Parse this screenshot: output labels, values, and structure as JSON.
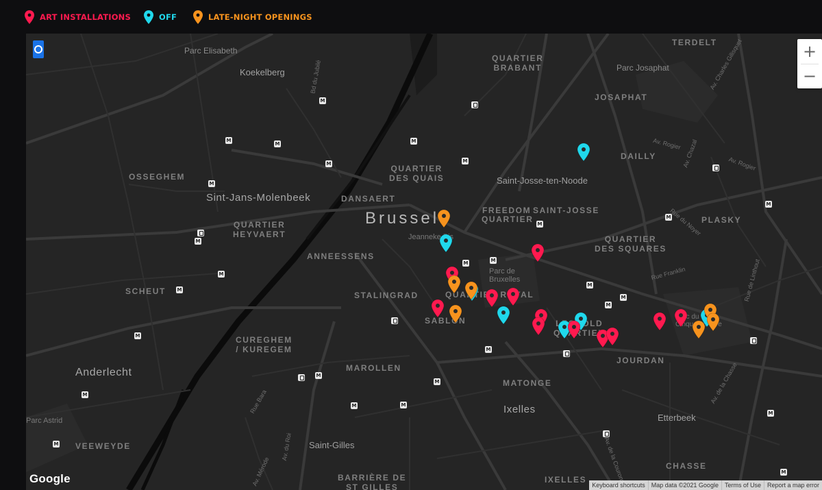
{
  "legend": {
    "items": [
      {
        "label": "ART INSTALLATIONS",
        "color": "#ff1a4f",
        "icon": "map-pin-icon"
      },
      {
        "label": "OFF",
        "color": "#20d8ec",
        "icon": "map-pin-icon"
      },
      {
        "label": "LATE-NIGHT OPENINGS",
        "color": "#f7931e",
        "icon": "map-pin-icon"
      }
    ]
  },
  "map": {
    "city": "Brussels",
    "towns": {
      "anderlecht": "Anderlecht",
      "ixelles": "Ixelles",
      "molenbeek": "Sint-Jans-Molenbeek",
      "saint_josse": "Saint-Josse-ten-Noode",
      "saint_gilles": "Saint-Gilles",
      "koekelberg": "Koekelberg",
      "etterbeek": "Etterbeek"
    },
    "districts": {
      "terdelt": "TERDELT",
      "quartier_brabant": "QUARTIER\nBRABANT",
      "josaphat": "JOSAPHAT",
      "dailly": "DAILLY",
      "osseghem": "OSSEGHEM",
      "quartier_quais": "QUARTIER\nDES QUAIS",
      "dansaert": "DANSAERT",
      "freedom": "FREEDOM",
      "saint_josse_q": "SAINT-JOSSE",
      "quartier": "QUARTIER",
      "plasky": "PLASKY",
      "heyvaert": "QUARTIER\nHEYVAERT",
      "squares": "QUARTIER\nDES SQUARES",
      "anneessens": "ANNEESSENS",
      "stalingrad": "STALINGRAD",
      "quartier_royal": "QUARTIER ROYAL",
      "scheut": "SCHEUT",
      "sablon": "SABLON",
      "leopold": "LEOPOLD\nQUARTIER",
      "jourdan": "JOURDAN",
      "cureghem": "CUREGHEM\n/ KUREGEM",
      "marollen": "MAROLLEN",
      "matonge": "MATONGE",
      "veeweyde": "VEEWEYDE",
      "barriere": "BARRIÈRE DE\nST GILLES",
      "ixelles_q": "IXELLES",
      "chasse": "CHASSE",
      "cinquantenaire": "Parc du\nCinquantenaire"
    },
    "places": {
      "parc_elisabeth": "Parc Elisabeth",
      "parc_josaphat": "Parc Josaphat",
      "jeanneke": "Jeanneke Pis",
      "parc_bruxelles": "Parc de\nBruxelles",
      "parc_astrid": "Parc Astrid"
    },
    "streets": {
      "s1": "Av. Charles Gilisquet",
      "s2": "Av. Rogier",
      "s3": "Av. Chazal",
      "s4": "Av. Rogier",
      "s5": "Rue du Noyer",
      "s6": "Rue Franklin",
      "s7": "Rue de Linthout",
      "s8": "Av. de la Chasse",
      "s9": "Rue Bara",
      "s10": "Av. du Roi",
      "s11": "Av. de la Couronne",
      "s12": "Bd du Jubilé",
      "s13": "Av. Mérode"
    },
    "controls": {
      "zoom_in": "+",
      "zoom_out": "−"
    },
    "logo": "Google",
    "attribution": {
      "shortcuts": "Keyboard shortcuts",
      "data": "Map data ©2021 Google",
      "terms": "Terms of Use",
      "report": "Report a map error"
    },
    "metro_glyph": "M"
  },
  "markers": [
    {
      "category": "late-night",
      "color": "#f7931e"
    },
    {
      "category": "off",
      "color": "#20d8ec"
    },
    {
      "category": "art",
      "color": "#ff1a4f"
    },
    {
      "category": "art",
      "color": "#ff1a4f"
    },
    {
      "category": "late-night",
      "color": "#f7931e"
    },
    {
      "category": "off",
      "color": "#20d8ec"
    },
    {
      "category": "late-night",
      "color": "#f7931e"
    },
    {
      "category": "art",
      "color": "#ff1a4f"
    },
    {
      "category": "art",
      "color": "#ff1a4f"
    },
    {
      "category": "art",
      "color": "#ff1a4f"
    },
    {
      "category": "late-night",
      "color": "#f7931e"
    },
    {
      "category": "off",
      "color": "#20d8ec"
    },
    {
      "category": "art",
      "color": "#ff1a4f"
    },
    {
      "category": "art",
      "color": "#ff1a4f"
    },
    {
      "category": "off",
      "color": "#20d8ec"
    },
    {
      "category": "off",
      "color": "#20d8ec"
    },
    {
      "category": "art",
      "color": "#ff1a4f"
    },
    {
      "category": "art",
      "color": "#ff1a4f"
    },
    {
      "category": "art",
      "color": "#ff1a4f"
    },
    {
      "category": "off",
      "color": "#20d8ec"
    },
    {
      "category": "art",
      "color": "#ff1a4f"
    },
    {
      "category": "art",
      "color": "#ff1a4f"
    },
    {
      "category": "late-night",
      "color": "#f7931e"
    },
    {
      "category": "off",
      "color": "#20d8ec"
    },
    {
      "category": "late-night",
      "color": "#f7931e"
    },
    {
      "category": "late-night",
      "color": "#f7931e"
    }
  ]
}
